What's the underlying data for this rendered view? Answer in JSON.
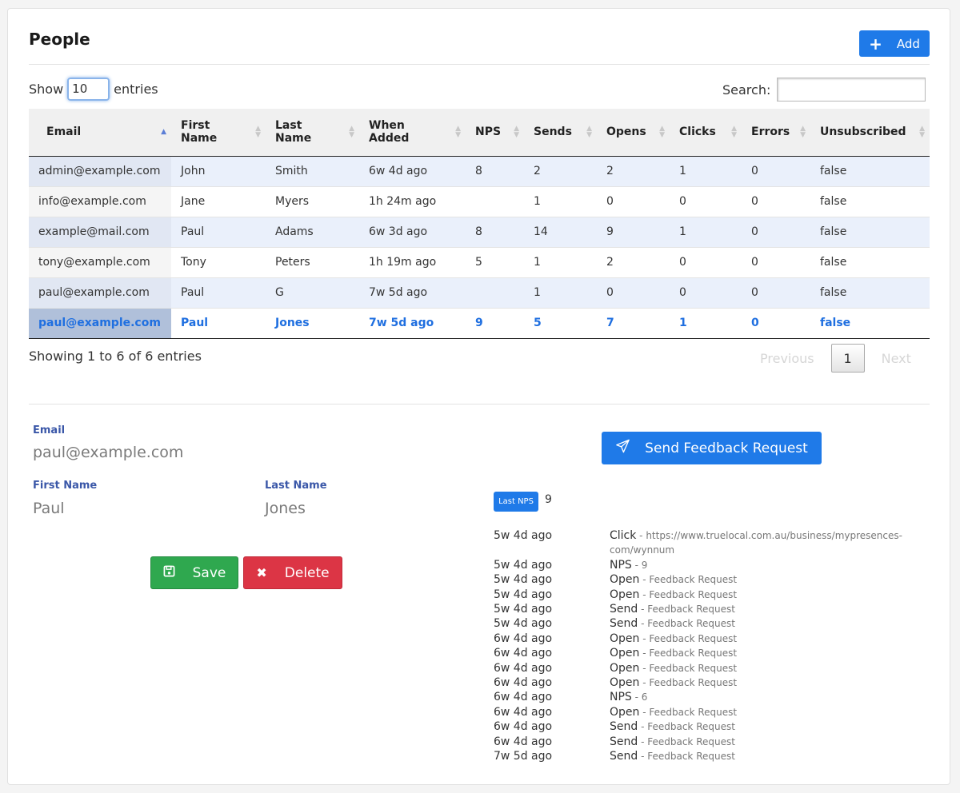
{
  "header": {
    "title": "People",
    "add_label": "Add"
  },
  "controls": {
    "show_prefix": "Show",
    "show_value": "10",
    "show_suffix": "entries",
    "search_label": "Search:",
    "search_value": ""
  },
  "table": {
    "columns": [
      "Email",
      "First Name",
      "Last Name",
      "When Added",
      "NPS",
      "Sends",
      "Opens",
      "Clicks",
      "Errors",
      "Unsubscribed"
    ],
    "rows": [
      [
        "admin@example.com",
        "John",
        "Smith",
        "6w 4d ago",
        "8",
        "2",
        "2",
        "1",
        "0",
        "false"
      ],
      [
        "info@example.com",
        "Jane",
        "Myers",
        "1h 24m ago",
        "",
        "1",
        "0",
        "0",
        "0",
        "false"
      ],
      [
        "example@mail.com",
        "Paul",
        "Adams",
        "6w 3d ago",
        "8",
        "14",
        "9",
        "1",
        "0",
        "false"
      ],
      [
        "tony@example.com",
        "Tony",
        "Peters",
        "1h 19m ago",
        "5",
        "1",
        "2",
        "0",
        "0",
        "false"
      ],
      [
        "paul@example.com",
        "Paul",
        "G",
        "7w 5d ago",
        "",
        "1",
        "0",
        "0",
        "0",
        "false"
      ],
      [
        "paul@example.com",
        "Paul",
        "Jones",
        "7w 5d ago",
        "9",
        "5",
        "7",
        "1",
        "0",
        "false"
      ]
    ]
  },
  "footer": {
    "info": "Showing 1 to 6 of 6 entries",
    "previous": "Previous",
    "page": "1",
    "next": "Next"
  },
  "detail": {
    "email_label": "Email",
    "email": "paul@example.com",
    "first_name_label": "First Name",
    "first_name": "Paul",
    "last_name_label": "Last Name",
    "last_name": "Jones",
    "save_label": "Save",
    "delete_label": "Delete",
    "send_label": "Send Feedback Request",
    "last_nps_label": "Last NPS",
    "last_nps": "9"
  },
  "events": [
    {
      "time": "5w 4d ago",
      "type": "Click",
      "meta": "https://www.truelocal.com.au/business/mypresences-com/wynnum"
    },
    {
      "time": "5w 4d ago",
      "type": "NPS",
      "meta": "9"
    },
    {
      "time": "5w 4d ago",
      "type": "Open",
      "meta": "Feedback Request"
    },
    {
      "time": "5w 4d ago",
      "type": "Open",
      "meta": "Feedback Request"
    },
    {
      "time": "5w 4d ago",
      "type": "Send",
      "meta": "Feedback Request"
    },
    {
      "time": "5w 4d ago",
      "type": "Send",
      "meta": "Feedback Request"
    },
    {
      "time": "6w 4d ago",
      "type": "Open",
      "meta": "Feedback Request"
    },
    {
      "time": "6w 4d ago",
      "type": "Open",
      "meta": "Feedback Request"
    },
    {
      "time": "6w 4d ago",
      "type": "Open",
      "meta": "Feedback Request"
    },
    {
      "time": "6w 4d ago",
      "type": "Open",
      "meta": "Feedback Request"
    },
    {
      "time": "6w 4d ago",
      "type": "NPS",
      "meta": "6"
    },
    {
      "time": "6w 4d ago",
      "type": "Open",
      "meta": "Feedback Request"
    },
    {
      "time": "6w 4d ago",
      "type": "Send",
      "meta": "Feedback Request"
    },
    {
      "time": "6w 4d ago",
      "type": "Send",
      "meta": "Feedback Request"
    },
    {
      "time": "7w 5d ago",
      "type": "Send",
      "meta": "Feedback Request"
    }
  ],
  "colors": {
    "primary": "#1f7ae8",
    "success": "#2fa84f",
    "danger": "#dc3545",
    "label": "#3a57a8"
  },
  "icons": {
    "add": "plus-icon",
    "save": "floppy-disk-icon",
    "delete": "close-icon",
    "send": "paper-plane-icon"
  }
}
